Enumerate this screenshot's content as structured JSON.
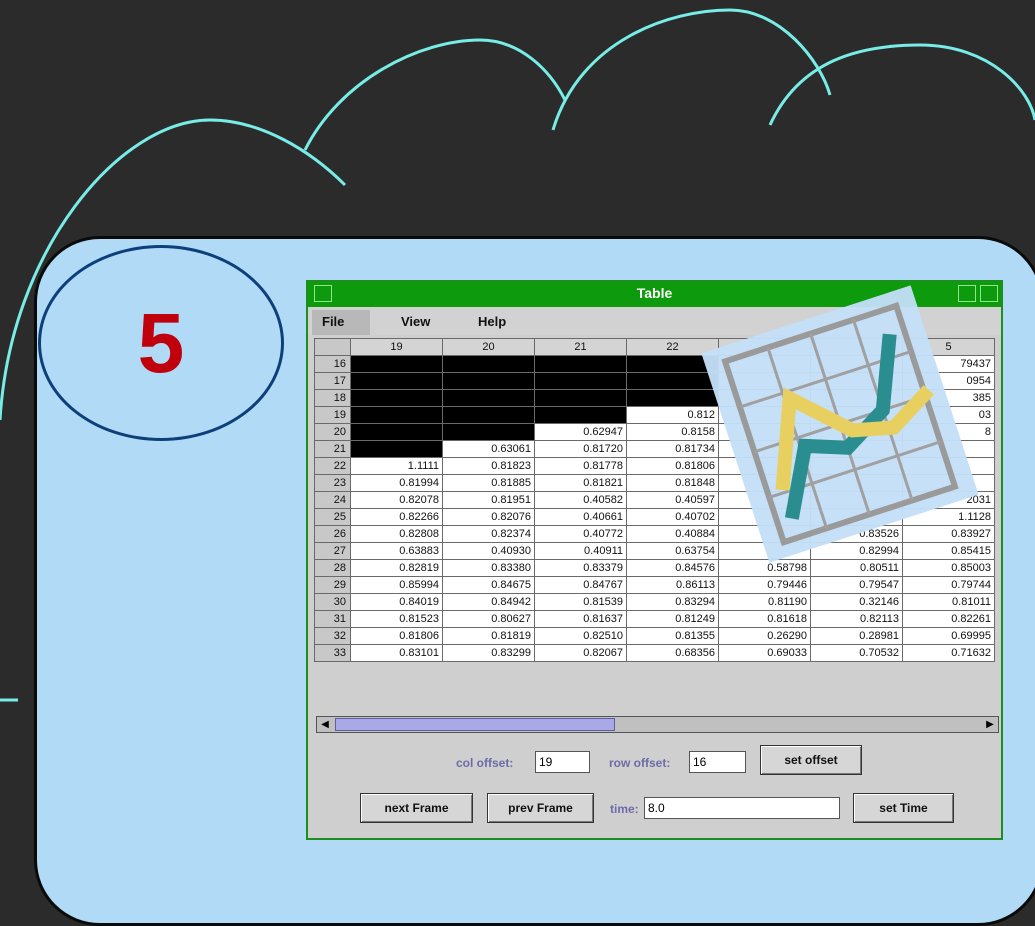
{
  "slide": {
    "number": "5"
  },
  "colors": {
    "background": "#2b2b2b",
    "cloud": "#78ece6",
    "panel": "#b0daf6",
    "badge_border": "#0d3f7a",
    "badge_number": "#c0000d",
    "titlebar": "#0d9a0d"
  },
  "window": {
    "title": "Table"
  },
  "menu": {
    "file": "File",
    "view": "View",
    "help": "Help"
  },
  "table": {
    "columns": [
      "19",
      "20",
      "21",
      "22",
      "",
      "",
      "5"
    ],
    "rows": [
      {
        "h": "16",
        "c": [
          "#",
          "#",
          "#",
          "#",
          "",
          "",
          "79437"
        ]
      },
      {
        "h": "17",
        "c": [
          "#",
          "#",
          "#",
          "#",
          "",
          "",
          "0954"
        ]
      },
      {
        "h": "18",
        "c": [
          "#",
          "#",
          "#",
          "#",
          "",
          "",
          "385"
        ]
      },
      {
        "h": "19",
        "c": [
          "#",
          "#",
          "#",
          "0.812",
          "",
          "",
          "03"
        ]
      },
      {
        "h": "20",
        "c": [
          "#",
          "#",
          "0.62947",
          "0.8158",
          "",
          "",
          "8"
        ]
      },
      {
        "h": "21",
        "c": [
          "#",
          "0.63061",
          "0.81720",
          "0.81734",
          "",
          "",
          ""
        ]
      },
      {
        "h": "22",
        "c": [
          "1.1111",
          "0.81823",
          "0.81778",
          "0.81806",
          "",
          "",
          ""
        ]
      },
      {
        "h": "23",
        "c": [
          "0.81994",
          "0.81885",
          "0.81821",
          "0.81848",
          "",
          "",
          ""
        ]
      },
      {
        "h": "24",
        "c": [
          "0.82078",
          "0.81951",
          "0.40582",
          "0.40597",
          "",
          "",
          "2031"
        ]
      },
      {
        "h": "25",
        "c": [
          "0.82266",
          "0.82076",
          "0.40661",
          "0.40702",
          "",
          "",
          "1.1128"
        ]
      },
      {
        "h": "26",
        "c": [
          "0.82808",
          "0.82374",
          "0.40772",
          "0.40884",
          "",
          "0.83526",
          "0.83927"
        ]
      },
      {
        "h": "27",
        "c": [
          "0.63883",
          "0.40930",
          "0.40911",
          "0.63754",
          "",
          "0.82994",
          "0.85415"
        ]
      },
      {
        "h": "28",
        "c": [
          "0.82819",
          "0.83380",
          "0.83379",
          "0.84576",
          "0.58798",
          "0.80511",
          "0.85003"
        ]
      },
      {
        "h": "29",
        "c": [
          "0.85994",
          "0.84675",
          "0.84767",
          "0.86113",
          "0.79446",
          "0.79547",
          "0.79744"
        ]
      },
      {
        "h": "30",
        "c": [
          "0.84019",
          "0.84942",
          "0.81539",
          "0.83294",
          "0.81190",
          "0.32146",
          "0.81011"
        ]
      },
      {
        "h": "31",
        "c": [
          "0.81523",
          "0.80627",
          "0.81637",
          "0.81249",
          "0.81618",
          "0.82113",
          "0.82261"
        ]
      },
      {
        "h": "32",
        "c": [
          "0.81806",
          "0.81819",
          "0.82510",
          "0.81355",
          "0.26290",
          "0.28981",
          "0.69995"
        ]
      },
      {
        "h": "33",
        "c": [
          "0.83101",
          "0.83299",
          "0.82067",
          "0.68356",
          "0.69033",
          "0.70532",
          "0.71632"
        ]
      }
    ]
  },
  "controls": {
    "col_offset_label": "col offset:",
    "col_offset_value": "19",
    "row_offset_label": "row offset:",
    "row_offset_value": "16",
    "set_offset": "set offset",
    "next_frame": "next Frame",
    "prev_frame": "prev Frame",
    "time_label": "time:",
    "time_value": "8.0",
    "set_time": "set Time"
  }
}
